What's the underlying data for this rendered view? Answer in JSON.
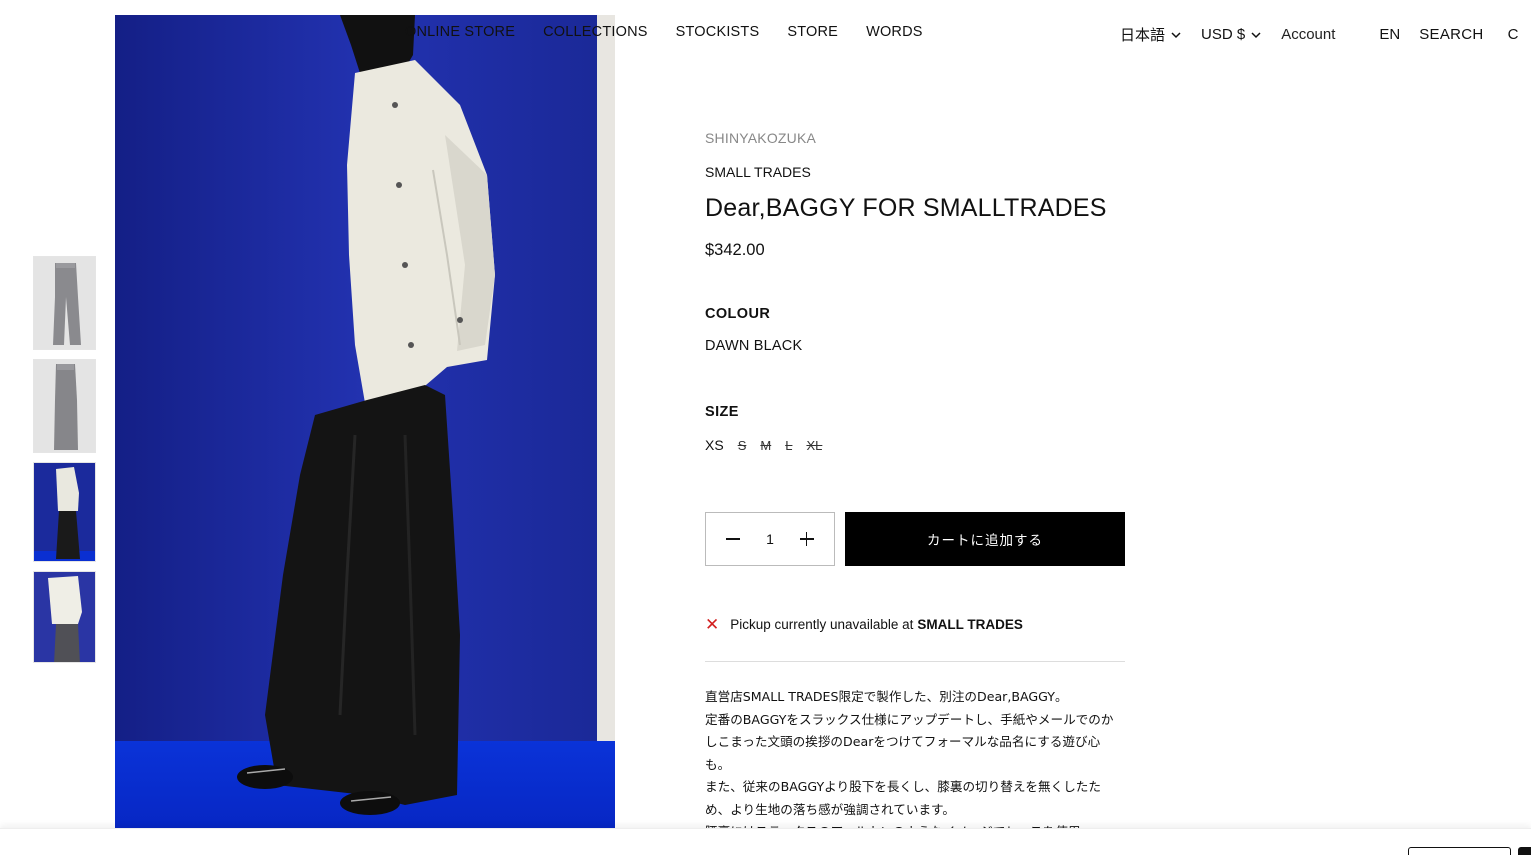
{
  "nav": {
    "items": [
      "ONLINE STORE",
      "COLLECTIONS",
      "STOCKISTS",
      "STORE",
      "WORDS"
    ]
  },
  "utility": {
    "language_select": "日本語",
    "currency_select": "USD $",
    "account": "Account",
    "lang_code": "EN",
    "search": "SEARCH",
    "cart": "C"
  },
  "product": {
    "vendor": "SHINYAKOZUKA",
    "store": "SMALL TRADES",
    "title": "Dear,BAGGY FOR SMALLTRADES",
    "price": "$342.00",
    "colour_label": "COLOUR",
    "colour_value": "DAWN BLACK",
    "size_label": "SIZE",
    "sizes": [
      {
        "label": "XS",
        "available": true
      },
      {
        "label": "S",
        "available": false
      },
      {
        "label": "M",
        "available": false
      },
      {
        "label": "L",
        "available": false
      },
      {
        "label": "XL",
        "available": false
      }
    ],
    "quantity": "1",
    "add_to_cart": "カートに追加する"
  },
  "pickup": {
    "icon": "close-icon",
    "text": "Pickup currently unavailable at",
    "location": "SMALL TRADES",
    "icon_color": "#d21f1f"
  },
  "description": {
    "lines": [
      "直営店SMALL TRADES限定で製作した、別注のDear,BAGGY。",
      "定番のBAGGYをスラックス仕様にアップデートし、手紙やメールでのかしこまった文頭の挨拶のDearをつけてフォーマルな品名にする遊び心も。",
      "また、従来のBAGGYより股下を長くし、膝裏の切り替えを無くしたため、より生地の落ち感が強調されています。",
      "腰裏にはスラックスのアールカンのようなイメージでレースを使用。"
    ]
  },
  "colors": {
    "backdrop_blue": "#1b2a9c",
    "floor_blue": "#0a2fd1",
    "button_black": "#000000"
  }
}
